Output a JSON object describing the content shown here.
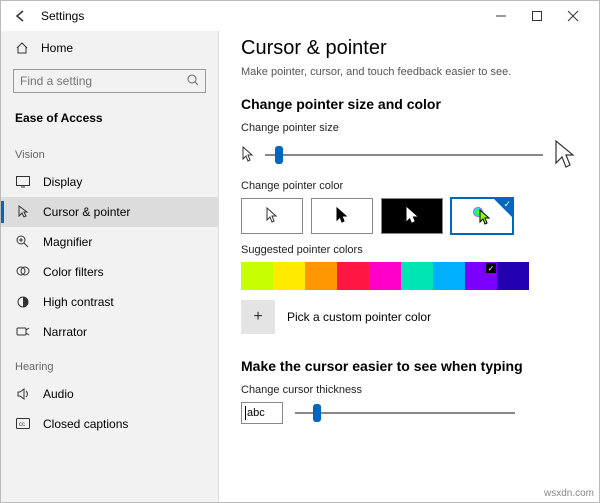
{
  "titlebar": {
    "title": "Settings"
  },
  "sidebar": {
    "home": "Home",
    "search_placeholder": "Find a setting",
    "category": "Ease of Access",
    "groups": {
      "vision": {
        "label": "Vision",
        "items": [
          {
            "label": "Display"
          },
          {
            "label": "Cursor & pointer"
          },
          {
            "label": "Magnifier"
          },
          {
            "label": "Color filters"
          },
          {
            "label": "High contrast"
          },
          {
            "label": "Narrator"
          }
        ]
      },
      "hearing": {
        "label": "Hearing",
        "items": [
          {
            "label": "Audio"
          },
          {
            "label": "Closed captions"
          }
        ]
      }
    }
  },
  "main": {
    "heading": "Cursor & pointer",
    "subtitle": "Make pointer, cursor, and touch feedback easier to see.",
    "section_size_color": "Change pointer size and color",
    "pointer_size_label": "Change pointer size",
    "pointer_size_value": 5,
    "pointer_color_label": "Change pointer color",
    "suggested_label": "Suggested pointer colors",
    "suggested_colors": [
      "#c6ff00",
      "#ffea00",
      "#ff9800",
      "#ff1744",
      "#ff00c8",
      "#00e5b4",
      "#00b0ff",
      "#7c00ff",
      "#2300b0"
    ],
    "suggested_selected_index": 7,
    "custom_label": "Pick a custom pointer color",
    "section_cursor": "Make the cursor easier to see when typing",
    "cursor_thickness_label": "Change cursor thickness",
    "cursor_thickness_value": 10,
    "abc_text": "abc"
  },
  "watermark": "wsxdn.com"
}
